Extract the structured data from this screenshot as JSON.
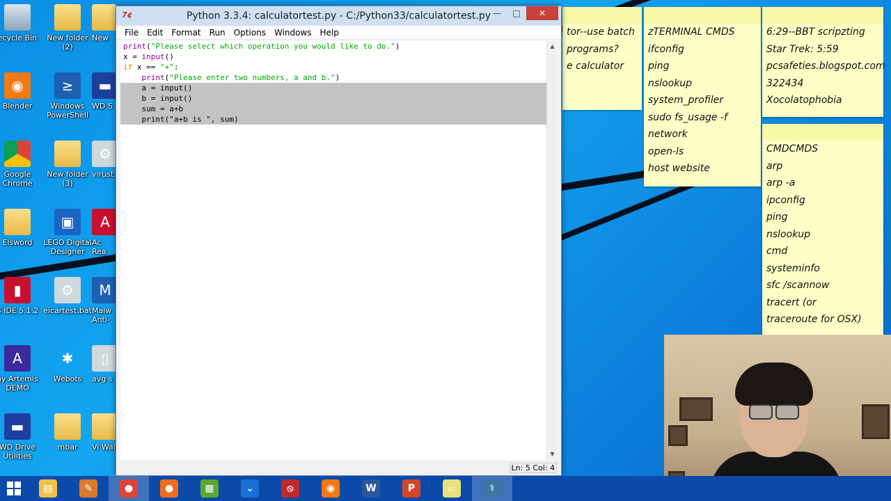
{
  "desktop": {
    "icons": [
      {
        "label": "ecycle Bin",
        "icon": "recycle-bin-icon"
      },
      {
        "label": "New folder (2)",
        "icon": "folder-icon"
      },
      {
        "label": "New",
        "icon": "folder-icon"
      },
      {
        "label": "Blender",
        "icon": "blender-icon"
      },
      {
        "label": "Windows PowerShell",
        "icon": "powershell-icon"
      },
      {
        "label": "WD S",
        "icon": "wd-icon"
      },
      {
        "label": "Google Chrome",
        "icon": "chrome-icon"
      },
      {
        "label": "New folder (3)",
        "icon": "folder-icon"
      },
      {
        "label": "virust",
        "icon": "gear-icon"
      },
      {
        "label": "Elsword",
        "icon": "folder-icon"
      },
      {
        "label": "LEGO Digital Designer",
        "icon": "lego-icon"
      },
      {
        "label": "Ac Rea",
        "icon": "acrobat-icon"
      },
      {
        "label": "S IDE 5.1.2",
        "icon": "ide-icon"
      },
      {
        "label": "eicartest.bat",
        "icon": "gear-icon"
      },
      {
        "label": "Malw Anti-",
        "icon": "malware-icon"
      },
      {
        "label": "ay Artemis DEMO",
        "icon": "artemis-icon"
      },
      {
        "label": "Webots",
        "icon": "bug-icon"
      },
      {
        "label": "avg s",
        "icon": "avg-icon"
      },
      {
        "label": "WD Drive Utilities",
        "icon": "wd-icon"
      },
      {
        "label": "mbar",
        "icon": "folder-icon"
      },
      {
        "label": "Vi Wal",
        "icon": "folder-icon"
      }
    ]
  },
  "window": {
    "title": "Python 3.3.4: calculatortest.py - C:/Python33/calculatortest.py",
    "app_icon": "7¢",
    "menu": [
      "File",
      "Edit",
      "Format",
      "Run",
      "Options",
      "Windows",
      "Help"
    ],
    "status": "Ln: 5 Col: 4",
    "code": [
      {
        "tokens": [
          [
            "kw-builtin",
            "print"
          ],
          [
            "plain",
            "("
          ],
          [
            "str",
            "\"Please select which operation you would like to do.\""
          ],
          [
            "plain",
            ")"
          ]
        ],
        "selected": false
      },
      {
        "tokens": [
          [
            "plain",
            "x = "
          ],
          [
            "kw-builtin",
            "input"
          ],
          [
            "plain",
            "()"
          ]
        ],
        "selected": false
      },
      {
        "tokens": [
          [
            "kw",
            "if"
          ],
          [
            "plain",
            " x == "
          ],
          [
            "str",
            "\"+\""
          ],
          [
            "plain",
            ":"
          ]
        ],
        "selected": false
      },
      {
        "tokens": [
          [
            "plain",
            "    "
          ],
          [
            "kw-builtin",
            "print"
          ],
          [
            "plain",
            "("
          ],
          [
            "str",
            "\"Please enter two numbers, a and b.\""
          ],
          [
            "plain",
            ")"
          ]
        ],
        "selected": false
      },
      {
        "tokens": [
          [
            "plain",
            "    a = input()"
          ]
        ],
        "selected": true
      },
      {
        "tokens": [
          [
            "plain",
            "    b = input()"
          ]
        ],
        "selected": true
      },
      {
        "tokens": [
          [
            "plain",
            "    sum = a+b"
          ]
        ],
        "selected": true
      },
      {
        "tokens": [
          [
            "plain",
            "    print(\"a+b is \", sum)"
          ]
        ],
        "selected": true
      }
    ]
  },
  "notes": [
    {
      "lines": [
        "tor--use batch",
        "programs?",
        "e calculator"
      ]
    },
    {
      "lines": [
        "zTERMINAL CMDS",
        "ifconfig",
        "ping",
        "nslookup",
        "system_profiler",
        "sudo fs_usage -f",
        "network",
        "open-ls",
        "host website"
      ]
    },
    {
      "lines": [
        "6:29--BBT scripzting",
        "Star Trek: 5:59",
        "pcsafeties.blogspot.com",
        "322434",
        " Xocolatophobia"
      ]
    },
    {
      "lines": [
        "CMDCMDS",
        "arp",
        "arp -a",
        "ipconfig",
        "ping",
        "nslookup",
        "cmd",
        "systeminfo",
        "sfc /scannow",
        "tracert (or",
        "traceroute for OSX)"
      ]
    }
  ],
  "taskbar": {
    "items": [
      {
        "name": "file-explorer-icon",
        "glyph": "▤",
        "color": "#f0c24b"
      },
      {
        "name": "app-icon",
        "glyph": "✎",
        "color": "#d97b2b"
      },
      {
        "name": "chrome-icon",
        "glyph": "●",
        "color": "#db4437"
      },
      {
        "name": "firefox-icon",
        "glyph": "●",
        "color": "#f26b1d"
      },
      {
        "name": "photos-icon",
        "glyph": "▦",
        "color": "#5aa832"
      },
      {
        "name": "chevron-icon",
        "glyph": "⌄",
        "color": "#1a6fd6"
      },
      {
        "name": "blocked-icon",
        "glyph": "⦸",
        "color": "#c0282d"
      },
      {
        "name": "blender-icon",
        "glyph": "◉",
        "color": "#f27a13"
      },
      {
        "name": "word-icon",
        "glyph": "W",
        "color": "#2b579a"
      },
      {
        "name": "powerpoint-icon",
        "glyph": "P",
        "color": "#d24726"
      },
      {
        "name": "sticky-notes-icon",
        "glyph": "▱",
        "color": "#e7e27a"
      },
      {
        "name": "python-icon",
        "glyph": "⚕",
        "color": "#3b76a8"
      }
    ]
  }
}
